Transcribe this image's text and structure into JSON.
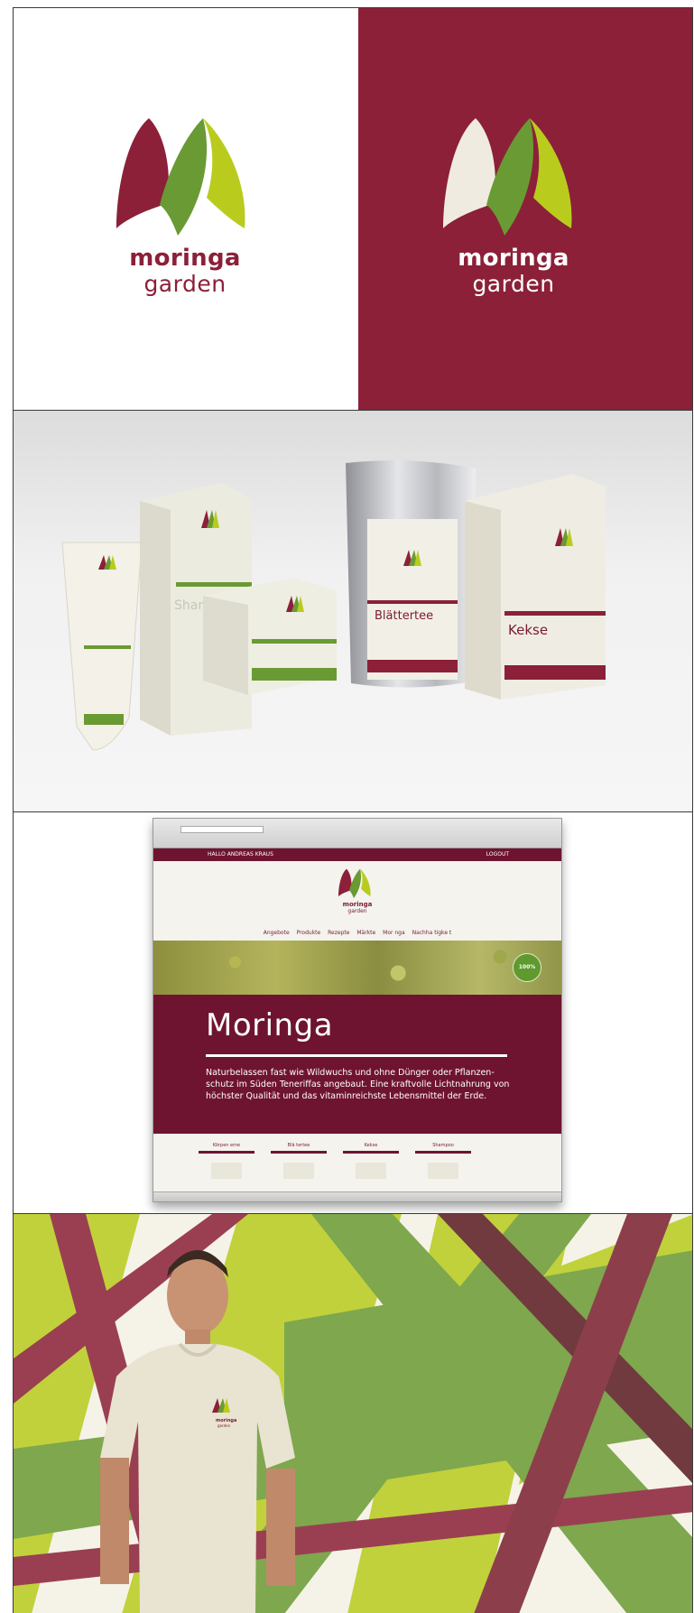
{
  "brand": {
    "line1": "moringa",
    "line2": "garden",
    "small_line1": "moringa",
    "small_line2": "garden",
    "colors": {
      "burgundy": "#8b2038",
      "olive": "#6a9a34",
      "lime": "#b9cc1e",
      "cream": "#efebe0"
    }
  },
  "products": {
    "shampoo_label": "Shampoo",
    "tea_label": "Blättertee",
    "cookies_label": "Kekse"
  },
  "website": {
    "greeting": "HALLO ANDREAS KRAUS",
    "logout": "LOGOUT",
    "logo_line1": "moringa",
    "logo_line2": "garden",
    "nav": [
      "Angebote",
      "Produkte",
      "Rezepte",
      "Märkte",
      "Mor nga",
      "Nachha tigke t"
    ],
    "badge": "100%",
    "hero_title": "Moringa",
    "hero_text": "Naturbelassen fast wie Wildwuchs und ohne Dünger oder Pflanzen-schutz im Süden Teneriffas angebaut. Eine kraftvolle Lichtnahrung von höchster Qualität und das vitaminreichste Lebensmittel der Erde.",
    "cards": [
      "Körpen eme",
      "Blä tertee",
      "Kekse",
      "Shampoo"
    ]
  }
}
